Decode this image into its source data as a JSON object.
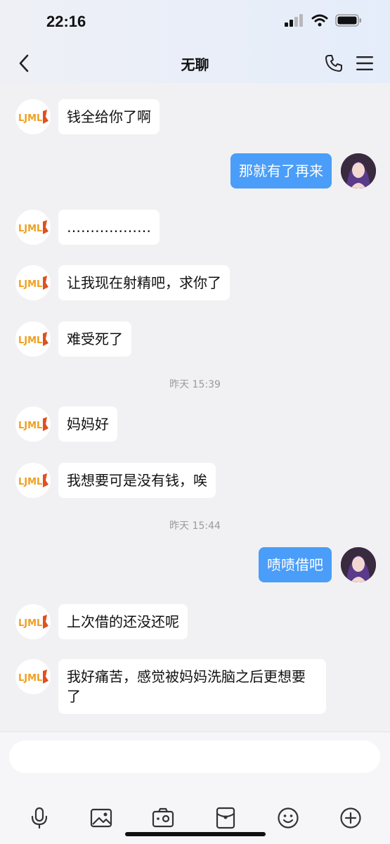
{
  "status_bar": {
    "time": "22:16"
  },
  "header": {
    "title": "无聊"
  },
  "messages": [
    {
      "sender": "other",
      "text": "钱全给你了啊"
    },
    {
      "sender": "self",
      "text": "那就有了再来"
    },
    {
      "sender": "other",
      "text": "………………"
    },
    {
      "sender": "other",
      "text": "让我现在射精吧，求你了"
    },
    {
      "sender": "other",
      "text": "难受死了"
    },
    {
      "sender": "other",
      "text": "妈妈好"
    },
    {
      "sender": "other",
      "text": "我想要可是没有钱，唉"
    },
    {
      "sender": "self",
      "text": "啧啧借吧"
    },
    {
      "sender": "other",
      "text": "上次借的还没还呢"
    },
    {
      "sender": "other",
      "text": "我好痛苦，感觉被妈妈洗脑之后更想要了"
    }
  ],
  "timestamps": [
    "昨天 15:39",
    "昨天 15:44"
  ],
  "other_avatar": {
    "logo_text": "LJML"
  },
  "input": {
    "placeholder": ""
  },
  "toolbar_icons": [
    "microphone-icon",
    "image-icon",
    "camera-icon",
    "red-packet-icon",
    "emoji-icon",
    "plus-icon"
  ],
  "colors": {
    "self_bubble": "#4a9df8",
    "other_bubble": "#ffffff",
    "background": "#f1f1f3",
    "logo_orange": "#f0a020"
  }
}
